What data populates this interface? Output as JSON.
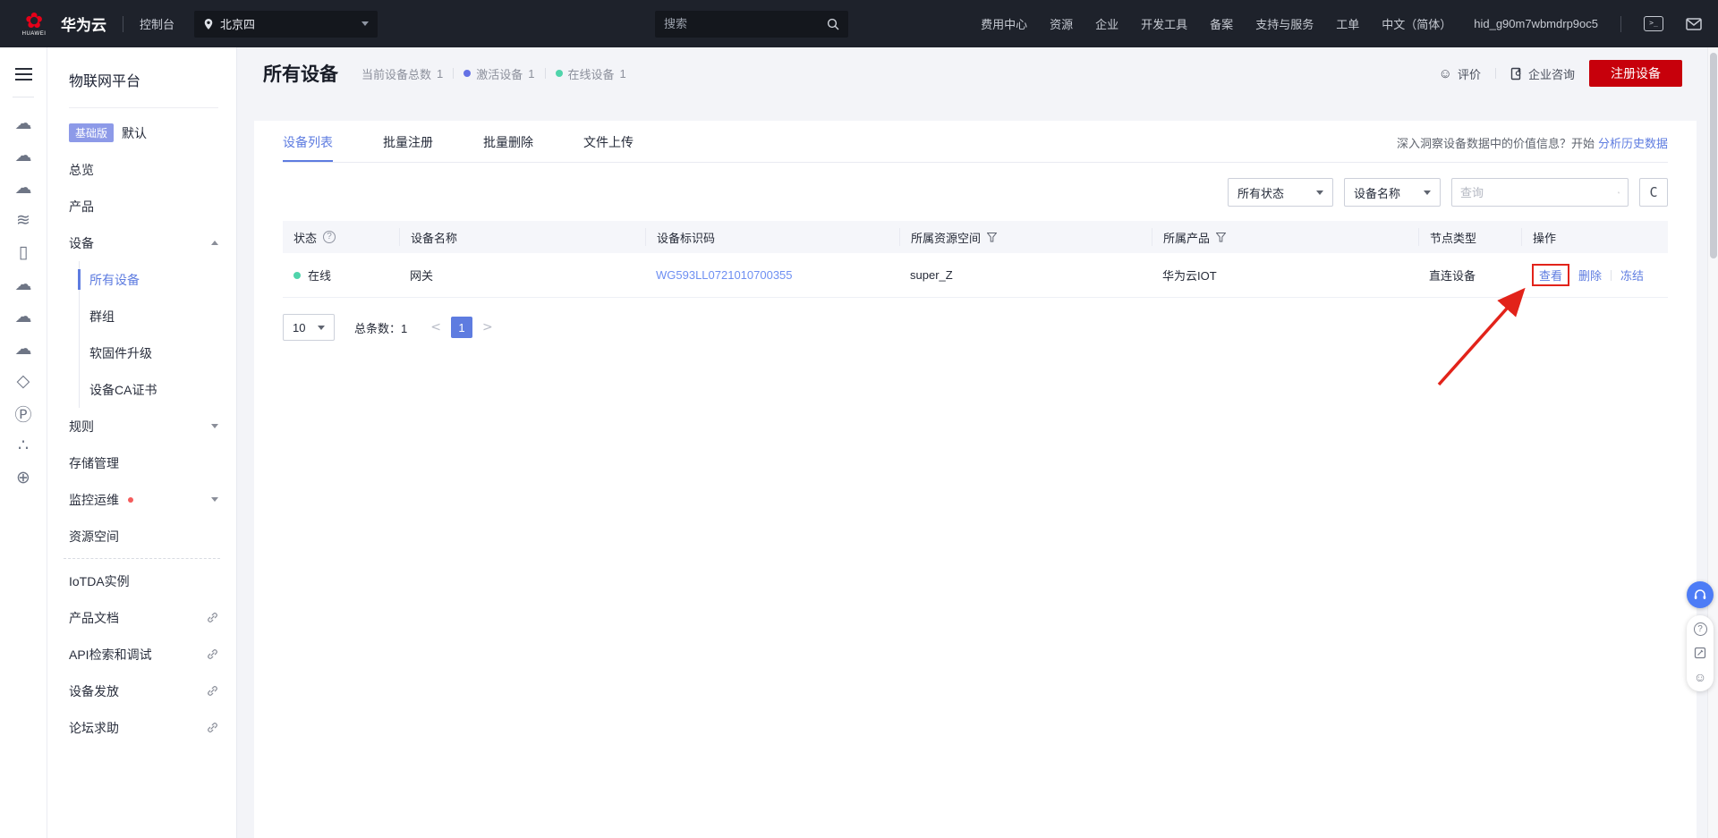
{
  "colors": {
    "accent": "#5e7ce0",
    "primary_red": "#c7000b",
    "online_green": "#50d4ab",
    "activated_blue": "#6471e5",
    "annotation_red": "#e2231a",
    "badge_bg": "#8d9ae8",
    "topbar_bg": "#1e222b"
  },
  "topbar": {
    "brand": "华为云",
    "brand_sub": "HUAWEI",
    "console": "控制台",
    "region": "北京四",
    "search_placeholder": "搜索",
    "menu": [
      "费用中心",
      "资源",
      "企业",
      "开发工具",
      "备案",
      "支持与服务",
      "工单",
      "中文（简体）"
    ],
    "account_id": "hid_g90m7wbmdrp9oc5",
    "icons": [
      "terminal-icon",
      "message-icon"
    ]
  },
  "rail": {
    "icons": [
      {
        "name": "cloud-server-icon",
        "glyph": "☁"
      },
      {
        "name": "cloud-api-icon",
        "glyph": "☁"
      },
      {
        "name": "cloud-data-icon",
        "glyph": "☁"
      },
      {
        "name": "signal-wave-icon",
        "glyph": "≋"
      },
      {
        "name": "mobile-device-icon",
        "glyph": "▯"
      },
      {
        "name": "cloud-icon",
        "glyph": "☁"
      },
      {
        "name": "cloud-upload-icon",
        "glyph": "☁"
      },
      {
        "name": "cloud-sync-icon",
        "glyph": "☁"
      },
      {
        "name": "prism-icon",
        "glyph": "◇"
      },
      {
        "name": "ip-address-icon",
        "glyph": "Ⓟ"
      },
      {
        "name": "node-cluster-icon",
        "glyph": "∴"
      },
      {
        "name": "globe-icon",
        "glyph": "⊕"
      }
    ]
  },
  "sidebar": {
    "title": "物联网平台",
    "badge": "基础版",
    "badge_label": "默认",
    "overview": "总览",
    "product": "产品",
    "device": "设备",
    "device_children": [
      "所有设备",
      "群组",
      "软固件升级",
      "设备CA证书"
    ],
    "rules": "规则",
    "storage": "存储管理",
    "monitor": "监控运维",
    "space": "资源空间",
    "iotda": "IoTDA实例",
    "links": [
      "产品文档",
      "API检索和调试",
      "设备发放",
      "论坛求助"
    ]
  },
  "page": {
    "title": "所有设备",
    "stats": [
      {
        "label": "当前设备总数",
        "value": "1"
      },
      {
        "label": "激活设备",
        "value": "1"
      },
      {
        "label": "在线设备",
        "value": "1"
      }
    ],
    "feedback": "评价",
    "consult": "企业咨询",
    "register": "注册设备"
  },
  "tabs": {
    "items": [
      "设备列表",
      "批量注册",
      "批量删除",
      "文件上传"
    ],
    "insight_text": "深入洞察设备数据中的价值信息？开始",
    "insight_link": "分析历史数据"
  },
  "filters": {
    "status": "所有状态",
    "field": "设备名称",
    "query_placeholder": "查询"
  },
  "table": {
    "columns": [
      "状态",
      "设备名称",
      "设备标识码",
      "所属资源空间",
      "所属产品",
      "节点类型",
      "操作"
    ],
    "row": {
      "status": "在线",
      "name": "网关",
      "device_id": "WG593LL0721010700355",
      "space": "super_Z",
      "product": "华为云IOT",
      "node_type": "直连设备",
      "actions": [
        "查看",
        "删除",
        "冻结"
      ]
    }
  },
  "pagination": {
    "page_size": "10",
    "total_label": "总条数：",
    "total_value": "1",
    "prev": "<",
    "page": "1",
    "next": ">"
  }
}
